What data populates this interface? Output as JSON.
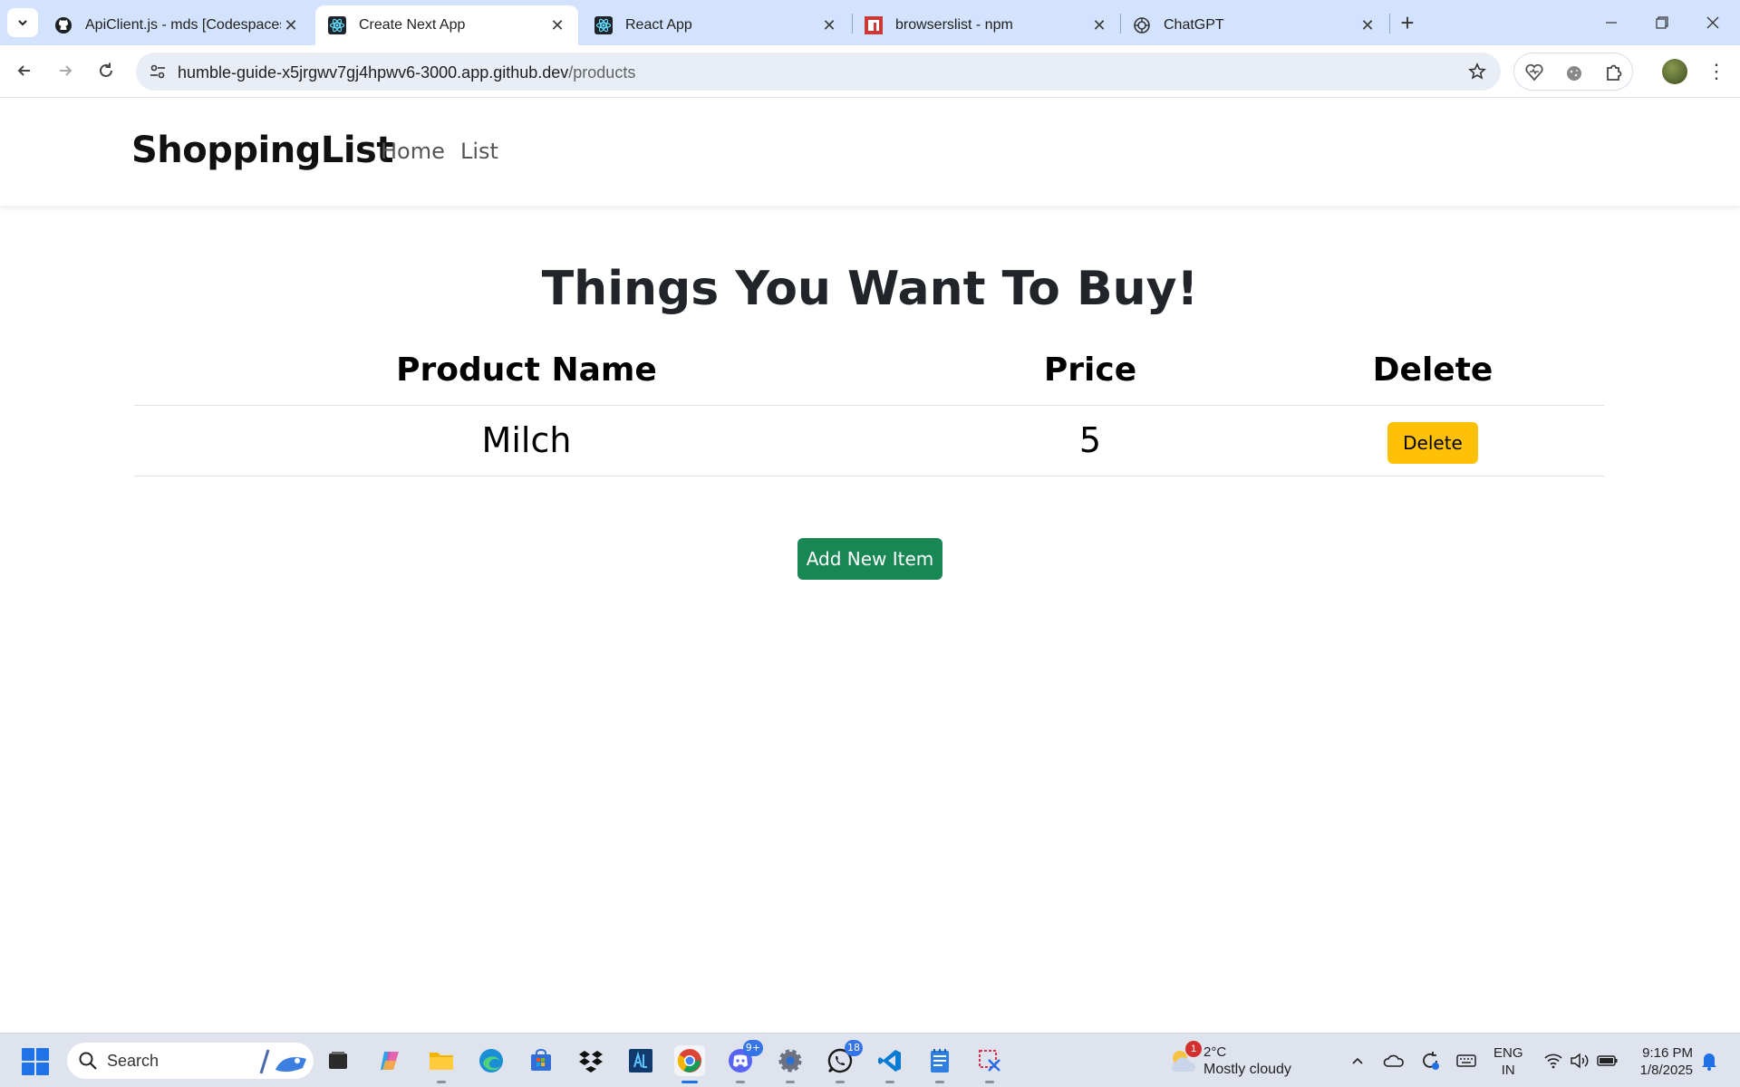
{
  "browser": {
    "tabs": [
      {
        "title": "ApiClient.js - mds [Codespaces:",
        "icon": "github-icon",
        "active": false
      },
      {
        "title": "Create Next App",
        "icon": "react-icon",
        "active": true
      },
      {
        "title": "React App",
        "icon": "react-icon",
        "active": false
      },
      {
        "title": "browserslist - npm",
        "icon": "npm-icon",
        "active": false
      },
      {
        "title": "ChatGPT",
        "icon": "chatgpt-icon",
        "active": false
      }
    ],
    "url_host": "humble-guide-x5jrgwv7gj4hpwv6-3000.app.github.dev",
    "url_path": "/products"
  },
  "app": {
    "brand": "ShoppingList",
    "nav": {
      "home": "Home",
      "list": "List"
    },
    "heading": "Things You Want To Buy!",
    "table": {
      "headers": {
        "name": "Product Name",
        "price": "Price",
        "delete": "Delete"
      },
      "rows": [
        {
          "name": "Milch",
          "price": "5",
          "delete_label": "Delete"
        }
      ]
    },
    "add_button": "Add New Item",
    "colors": {
      "delete_button": "#ffc107",
      "add_button": "#198754"
    }
  },
  "taskbar": {
    "search_label": "Search",
    "badges": {
      "discord": "9+",
      "whatsapp": "18"
    },
    "weather": {
      "badge": "1",
      "temp": "2°C",
      "condition": "Mostly cloudy"
    },
    "lang": {
      "line1": "ENG",
      "line2": "IN"
    },
    "clock": {
      "time": "9:16 PM",
      "date": "1/8/2025"
    }
  }
}
